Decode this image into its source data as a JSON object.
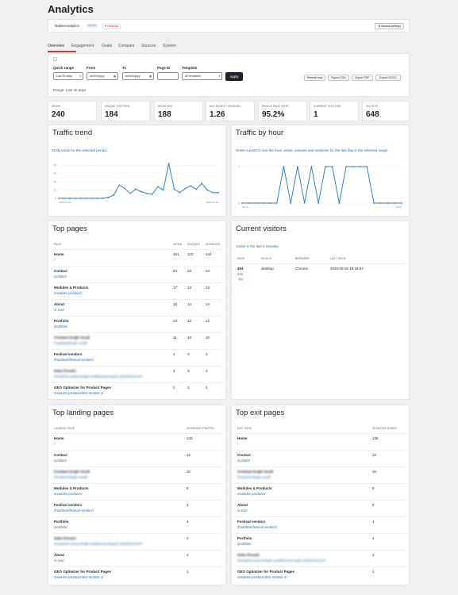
{
  "page_title": "Analytics",
  "plugin": {
    "name": "NativeAnalytics",
    "version": "v1.0.2",
    "badge": "Heatmap",
    "module_settings": "Module settings"
  },
  "tabs": [
    "Overview",
    "Engagement",
    "Goals",
    "Compare",
    "Sources",
    "System"
  ],
  "filters": {
    "quick_range_label": "Quick range",
    "quick_range_value": "Last 30 days",
    "from_label": "From",
    "from_value": "dd/mm/yyyy",
    "to_label": "To",
    "to_value": "dd/mm/yyyy",
    "page_id_label": "Page ID",
    "page_id_value": "",
    "template_label": "Template",
    "template_value": "All templates",
    "apply": "Apply",
    "refresh": "Refresh now",
    "export_csv": "Export CSV",
    "export_pdf": "Export PDF",
    "export_docx": "Export DOCX",
    "range_text": "Range: Last 30 days"
  },
  "stats": [
    {
      "label": "VIEWS",
      "value": "240"
    },
    {
      "label": "UNIQUE VISITORS",
      "value": "184"
    },
    {
      "label": "SESSIONS",
      "value": "188"
    },
    {
      "label": "AVG PAGES / SESSION",
      "value": "1.26"
    },
    {
      "label": "SINGLE PAGE RATE",
      "value": "95.2%"
    },
    {
      "label": "CURRENT VISITORS",
      "value": "1"
    },
    {
      "label": "404 HITS",
      "value": "648"
    }
  ],
  "traffic_trend": {
    "title": "Traffic trend",
    "subtitle": "Daily totals for the selected period.",
    "chart_data": {
      "type": "line",
      "x": [
        "2026-04-26",
        "",
        "",
        "",
        "",
        "",
        "",
        "",
        "",
        "",
        "",
        "",
        "",
        "",
        "",
        "",
        "",
        "",
        "",
        "",
        "",
        "",
        "",
        "",
        "",
        "",
        "",
        "",
        "",
        "2026-05-25"
      ],
      "series": [
        {
          "values": [
            0,
            0,
            0,
            0,
            0,
            0,
            0,
            0,
            0,
            1,
            4,
            16,
            12,
            6,
            11,
            8,
            6,
            5,
            14,
            10,
            42,
            11,
            7,
            12,
            15,
            11,
            18,
            10,
            7,
            7
          ]
        }
      ],
      "y_ticks": [
        "0",
        "10",
        "20",
        "30",
        "40"
      ],
      "ylim": [
        0,
        45
      ]
    }
  },
  "traffic_by_hour": {
    "title": "Traffic by hour",
    "subtitle": "Hover a point to see the hour, views, uniques and sessions for the last day in the selected range.",
    "chart_data": {
      "type": "line",
      "x": [
        "00:00",
        "",
        "",
        "",
        "",
        "",
        "",
        "",
        "",
        "",
        "",
        "",
        "",
        "",
        "",
        "",
        "",
        "",
        "",
        "",
        "",
        "",
        "",
        "23:00"
      ],
      "series": [
        {
          "values": [
            0,
            0,
            0,
            0,
            0,
            0,
            1,
            0,
            1,
            0,
            1,
            0,
            1,
            1,
            0,
            1,
            1,
            1,
            1,
            0,
            0,
            0,
            0,
            0
          ]
        }
      ],
      "y_ticks": [
        "0",
        "1"
      ],
      "ylim": [
        0,
        1
      ]
    }
  },
  "top_pages": {
    "title": "Top pages",
    "headers": [
      "PAGE",
      "VIEWS",
      "UNIQUES",
      "SESSIONS"
    ],
    "rows": [
      {
        "title": "Home",
        "path": "/",
        "views": "151",
        "uniques": "143",
        "sessions": "144"
      },
      {
        "title": "Contact",
        "path": "/contact/",
        "views": "24",
        "uniques": "23",
        "sessions": "23"
      },
      {
        "title": "Modules & Products",
        "path": "/modules-products/",
        "views": "17",
        "uniques": "13",
        "sessions": "13"
      },
      {
        "title": "About",
        "path": "/o-nas/",
        "views": "15",
        "uniques": "14",
        "sessions": "14"
      },
      {
        "title": "Portfolio",
        "path": "/portfolio/",
        "views": "13",
        "uniques": "12",
        "sessions": "12"
      },
      {
        "title": "Festiwal Drujki Small",
        "path": "/frontdesk/drujki-small/",
        "views": "11",
        "uniques": "10",
        "sessions": "10"
      },
      {
        "title": "Festival vendors",
        "path": "/frontdesk/festival-vendors/",
        "views": "4",
        "uniques": "3",
        "sessions": "4"
      },
      {
        "title": "Naka firma01",
        "path": "/frontdesk-entries/drujki-small/entries/nayzh-202605161457/",
        "views": "3",
        "uniques": "3",
        "sessions": "3"
      },
      {
        "title": "GEO Optimizer for Product Pages",
        "path": "/modules-products/test-module-1/",
        "views": "2",
        "uniques": "2",
        "sessions": "2"
      }
    ]
  },
  "current_visitors": {
    "title": "Current visitors",
    "subtitle": "Active in the last 5 minutes.",
    "headers": [
      "PAGE",
      "DEVICE",
      "BROWSER",
      "LAST SEEN"
    ],
    "rows": [
      {
        "page": "404",
        "path": "/rm/",
        "tag": "404",
        "device": "desktop",
        "browser": "Chrome",
        "last_seen": "2026-05-25 16:18:57"
      }
    ]
  },
  "top_landing": {
    "title": "Top landing pages",
    "headers": [
      "LANDING PAGE",
      "SESSIONS STARTED"
    ],
    "rows": [
      {
        "title": "Home",
        "path": "/",
        "value": "143"
      },
      {
        "title": "Contact",
        "path": "/contact/",
        "value": "12"
      },
      {
        "title": "Festiwal Drujki Small",
        "path": "/frontdesk/drujki-small/",
        "value": "10"
      },
      {
        "title": "Modules & Products",
        "path": "/modules-products/",
        "value": "8"
      },
      {
        "title": "Festival vendors",
        "path": "/frontdesk/festival-vendors/",
        "value": "4"
      },
      {
        "title": "Portfolio",
        "path": "/portfolio/",
        "value": "4"
      },
      {
        "title": "Naka firma01",
        "path": "/frontdesk-entries/drujki-small/entries/nayzh-202605161457/",
        "value": "3"
      },
      {
        "title": "About",
        "path": "/o-nas/",
        "value": "3"
      },
      {
        "title": "GEO Optimizer for Product Pages",
        "path": "/modules-products/test-module-1/",
        "value": "1"
      }
    ]
  },
  "top_exit": {
    "title": "Top exit pages",
    "headers": [
      "EXIT PAGE",
      "SESSIONS ENDED"
    ],
    "rows": [
      {
        "title": "Home",
        "path": "/",
        "value": "136"
      },
      {
        "title": "Contact",
        "path": "/contact/",
        "value": "12"
      },
      {
        "title": "Festiwal Drujki Small",
        "path": "/frontdesk/drujki-small/",
        "value": "10"
      },
      {
        "title": "Modules & Products",
        "path": "/modules-products/",
        "value": "9"
      },
      {
        "title": "About",
        "path": "/o-nas/",
        "value": "8"
      },
      {
        "title": "Festival vendors",
        "path": "/frontdesk/festival-vendors/",
        "value": "4"
      },
      {
        "title": "Portfolio",
        "path": "/portfolio/",
        "value": "4"
      },
      {
        "title": "Noka firma01",
        "path": "/frontdesk-entries/drujki-small/entries/nayzh-202605161457/",
        "value": "3"
      },
      {
        "title": "GEO Optimizer for Product Pages",
        "path": "/modules-products/test-module-1/",
        "value": "2"
      }
    ]
  },
  "colors": {
    "accent": "#2271b1",
    "line": "#3582c4",
    "danger": "#d63638"
  }
}
